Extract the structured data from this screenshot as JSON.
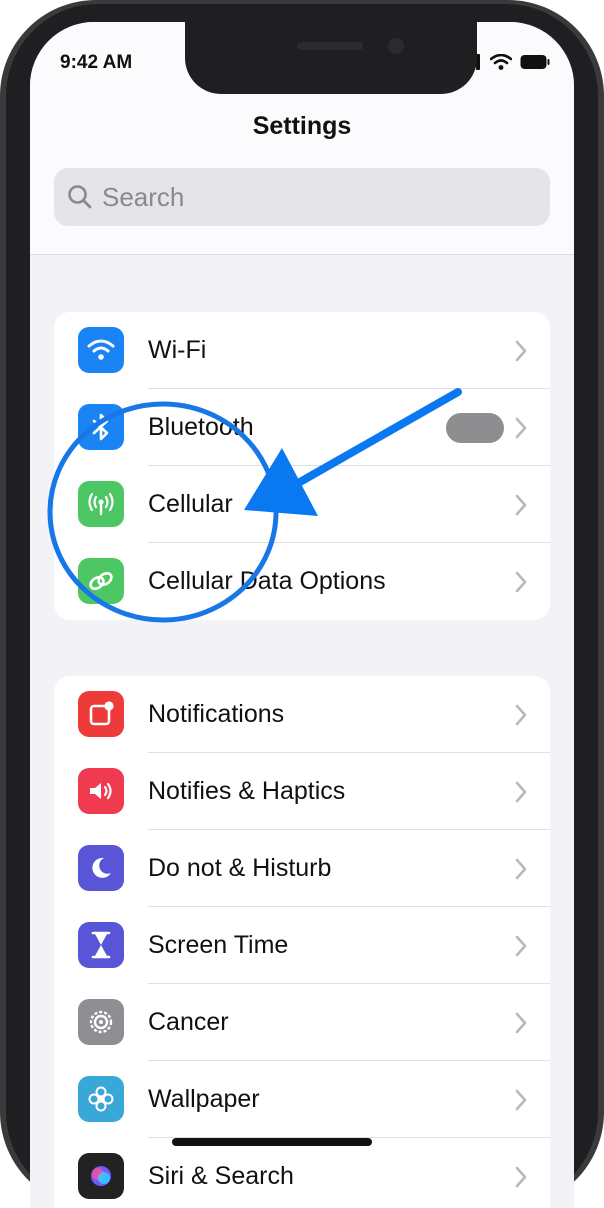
{
  "status_bar": {
    "time": "9:42 AM"
  },
  "header": {
    "title": "Settings"
  },
  "search": {
    "placeholder": "Search"
  },
  "groups": [
    {
      "items": [
        {
          "label": "Wi-Fi",
          "icon": "wifi-icon",
          "color": "#1b84f4"
        },
        {
          "label": "Bluetooth",
          "icon": "bluetooth-icon",
          "color": "#1b84f4"
        },
        {
          "label": "Cellular",
          "icon": "antenna-icon",
          "color": "#4cc764"
        },
        {
          "label": "Cellular Data Options",
          "icon": "chain-link-icon",
          "color": "#4cc764"
        }
      ]
    },
    {
      "items": [
        {
          "label": "Notifications",
          "icon": "notification-badge-icon",
          "color": "#ef3a3a"
        },
        {
          "label": "Notifies & Haptics",
          "icon": "speaker-icon",
          "color": "#ef3a4f"
        },
        {
          "label": "Do not & Histurb",
          "icon": "moon-icon",
          "color": "#5856d6"
        },
        {
          "label": "Screen Time",
          "icon": "hourglass-icon",
          "color": "#5856d6"
        },
        {
          "label": "Cancer",
          "icon": "gear-icon",
          "color": "#8e8e93"
        },
        {
          "label": "Wallpaper",
          "icon": "flower-icon",
          "color": "#3aa7d9"
        },
        {
          "label": "Siri & Search",
          "icon": "siri-icon",
          "color": "#222222"
        }
      ]
    }
  ],
  "colors": {
    "accent": "#1b84f4",
    "annotation": "#1877e6"
  }
}
